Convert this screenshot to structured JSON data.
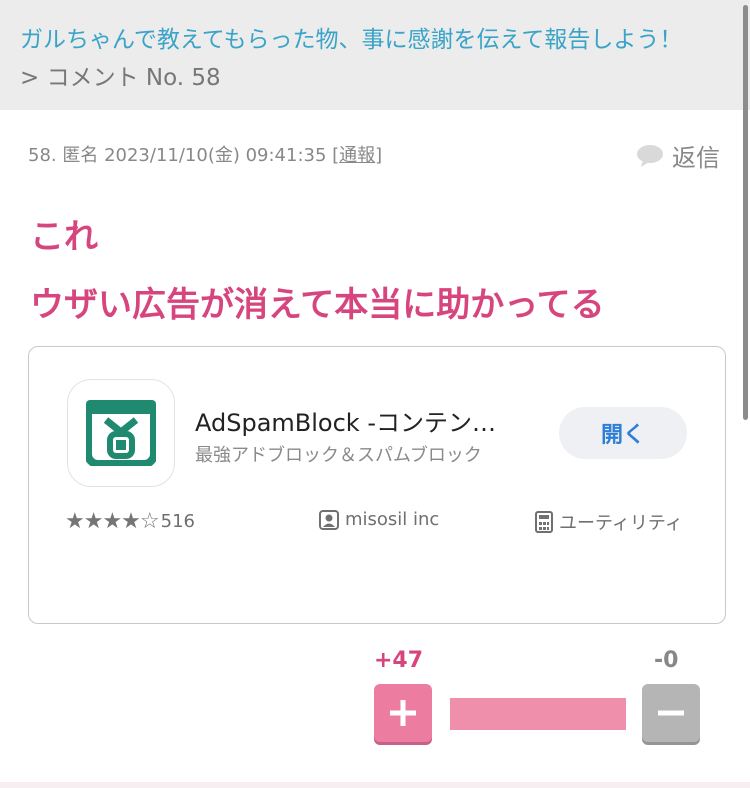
{
  "header": {
    "thread_title": "ガルちゃんで教えてもらった物、事に感謝を伝えて報告しよう！",
    "breadcrumb": "> コメント No. 58"
  },
  "comment": {
    "meta_prefix": "58. 匿名 2023/11/10(金) 09:41:35 [",
    "report_label": "通報",
    "meta_suffix": "]",
    "reply_label": "返信",
    "body_line1": "これ",
    "body_line2": "ウザい広告が消えて本当に助かってる"
  },
  "app_card": {
    "name": "AdSpamBlock -コンテン…",
    "subtitle": "最強アドブロック＆スパムブロック",
    "open_label": "開く",
    "stars": "★★★★☆",
    "rating_value": 4.5,
    "rating_count": "516",
    "developer": "misosil inc",
    "category": "ユーティリティ",
    "icon_color": "#1f8a70"
  },
  "votes": {
    "plus_count": "+47",
    "minus_count": "-0",
    "plus_fraction": 1.0
  },
  "colors": {
    "accent_pink": "#d6457e",
    "link_blue": "#3aa4c8"
  }
}
